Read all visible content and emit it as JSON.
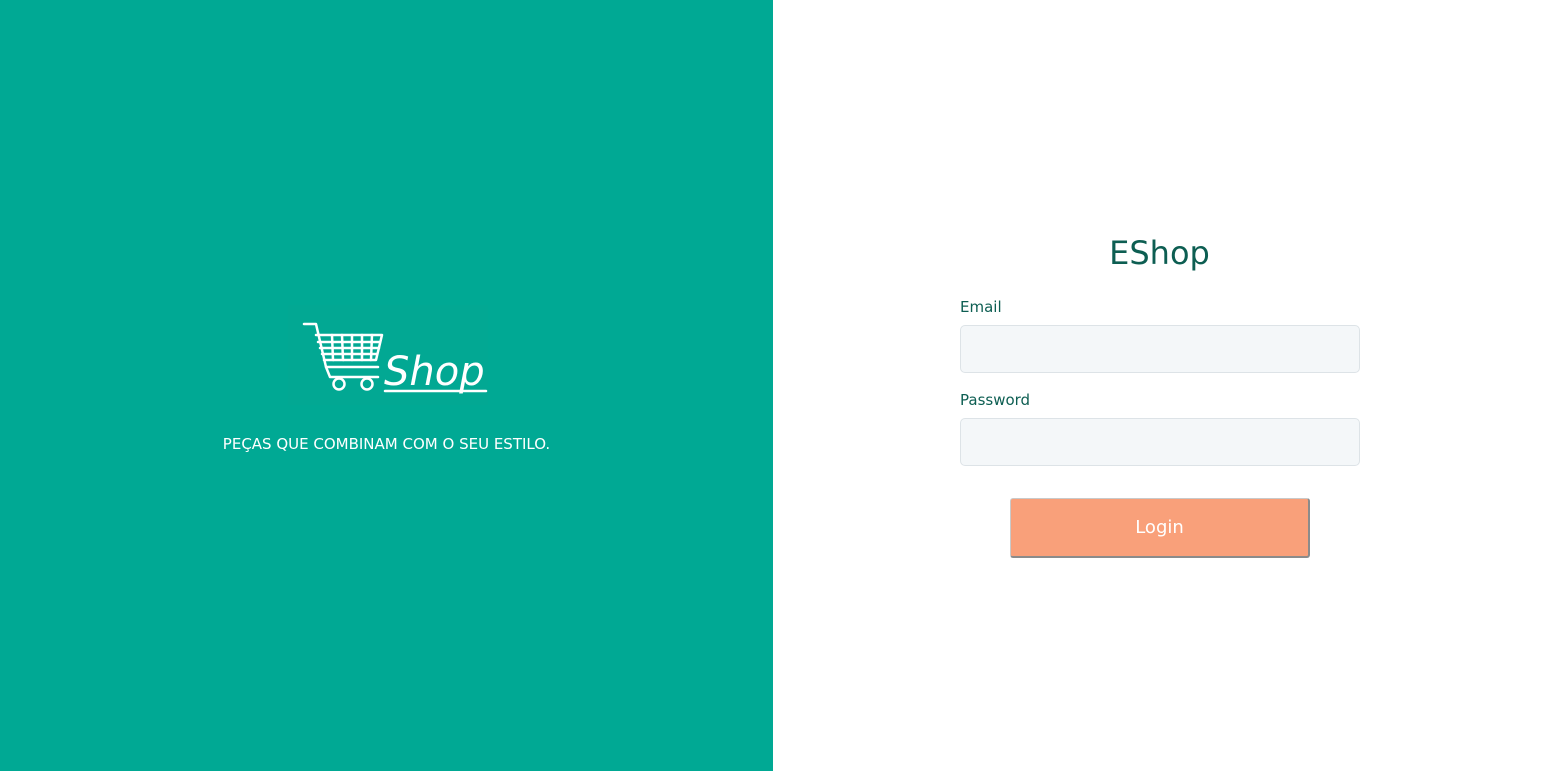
{
  "left_panel": {
    "logo_text": "Shop",
    "tagline": "PEÇAS QUE COMBINAM COM O SEU ESTILO."
  },
  "login_form": {
    "title": "EShop",
    "email_label": "Email",
    "email_value": "",
    "password_label": "Password",
    "password_value": "",
    "submit_label": "Login"
  },
  "colors": {
    "primary_teal": "#00a994",
    "title_dark_teal": "#0d5e52",
    "button_salmon": "#f9a07a",
    "input_background": "#f4f7f9"
  },
  "icons": {
    "logo_icon": "shopping-cart-icon"
  }
}
